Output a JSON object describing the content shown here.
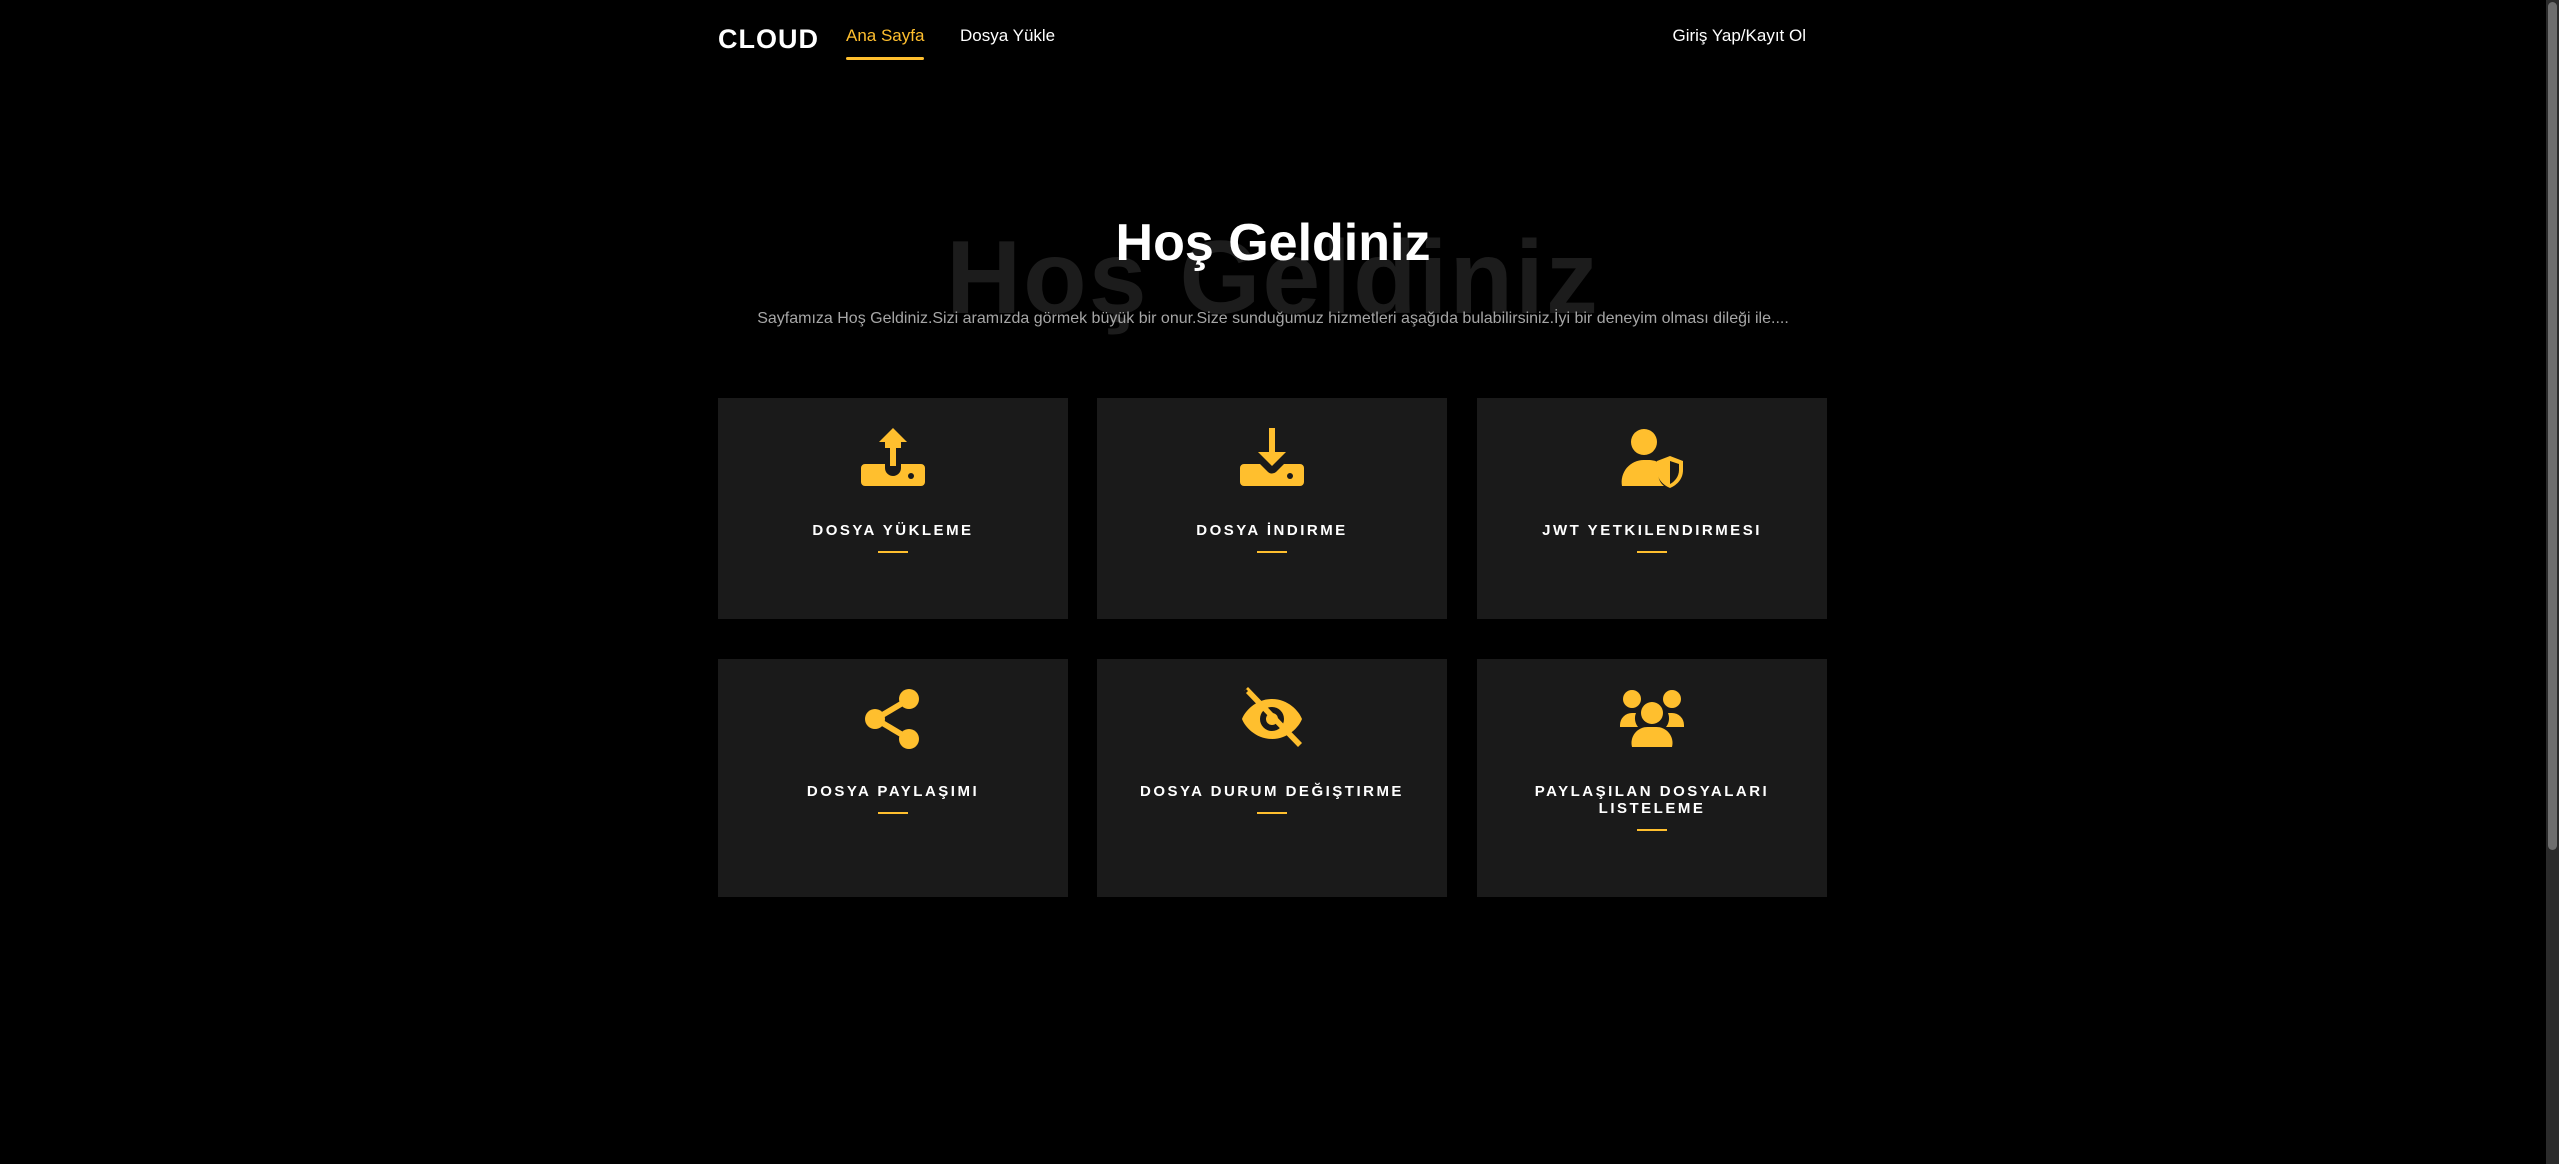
{
  "nav": {
    "brand": "CLOUD",
    "home": "Ana Sayfa",
    "upload": "Dosya Yükle",
    "login": "Giriş Yap/Kayıt Ol"
  },
  "hero": {
    "title": "Hoş Geldiniz",
    "shadow_title": "Hoş Geldiniz",
    "subtitle": "Sayfamıza Hoş Geldiniz.Sizi aramızda görmek büyük bir onur.Size sunduğumuz hizmetleri aşağıda bulabilirsiniz.İyi bir deneyim olması dileği ile...."
  },
  "services": [
    {
      "label": "DOSYA YÜKLEME",
      "icon": "upload-icon"
    },
    {
      "label": "DOSYA İNDIRME",
      "icon": "download-icon"
    },
    {
      "label": "JWT YETKILENDIRMESI",
      "icon": "user-shield-icon"
    },
    {
      "label": "DOSYA PAYLAŞIMI",
      "icon": "share-icon"
    },
    {
      "label": "DOSYA DURUM DEĞIŞTIRME",
      "icon": "eye-slash-icon"
    },
    {
      "label": "PAYLAŞILAN DOSYALARI LISTELEME",
      "icon": "users-icon"
    }
  ],
  "colors": {
    "accent": "#ffbf2e",
    "background": "#000000",
    "card": "#1a1a1a"
  }
}
